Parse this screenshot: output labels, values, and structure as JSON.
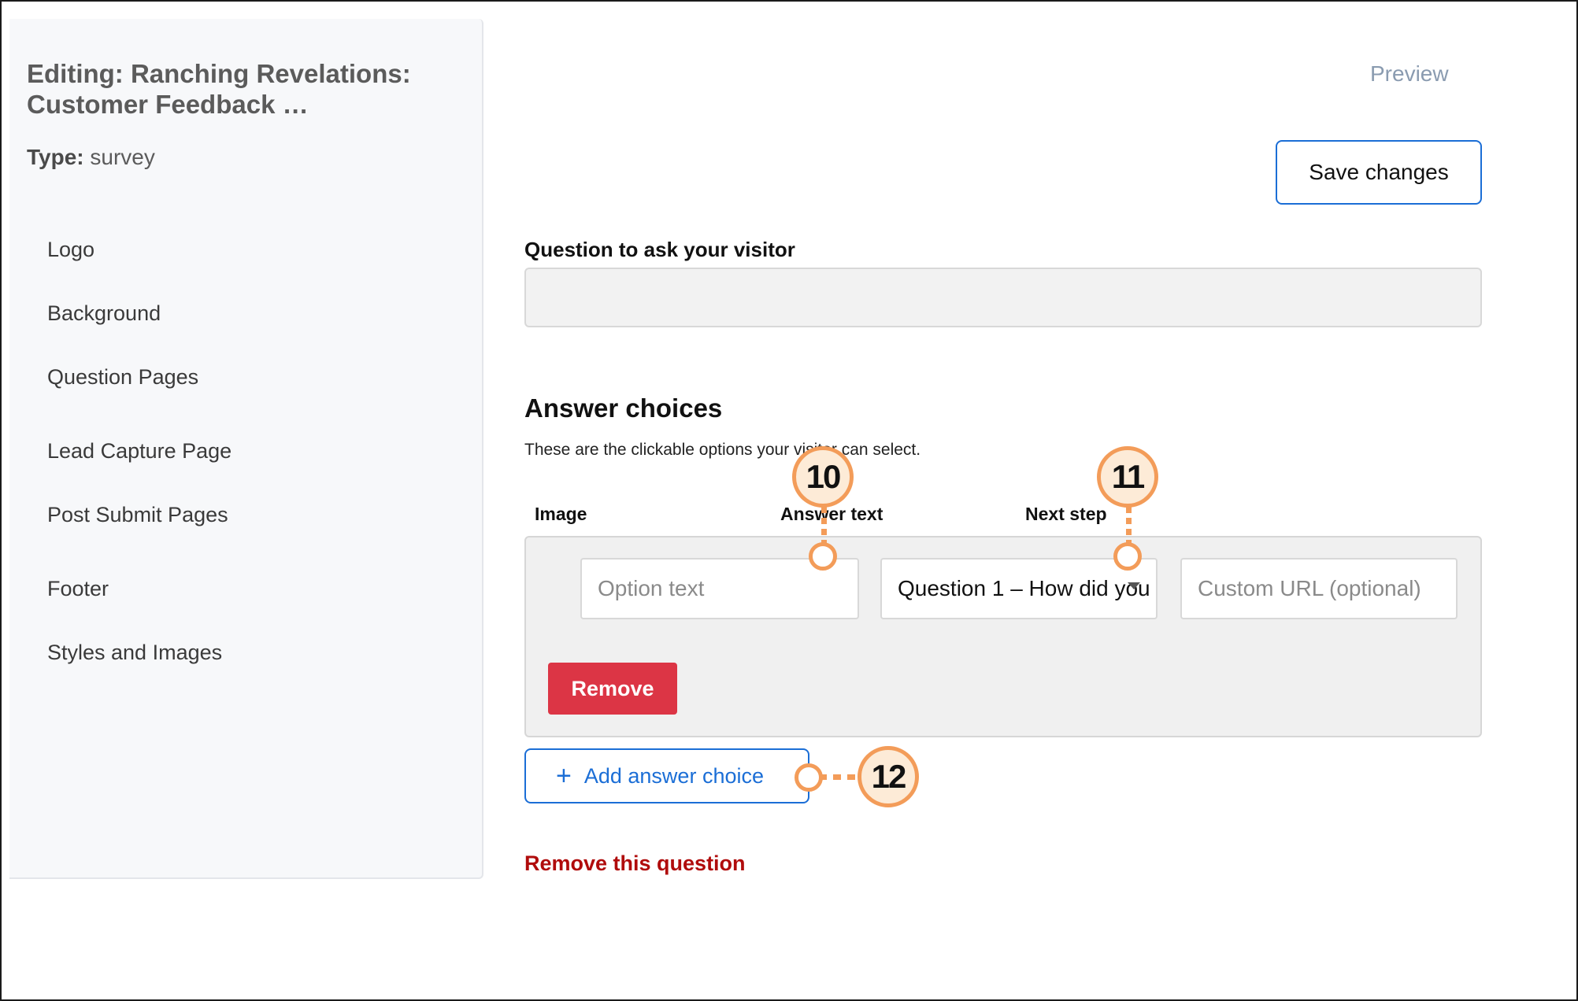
{
  "sidebar": {
    "title": "Editing: Ranching Revelations: Customer Feedback …",
    "type_label": "Type:",
    "type_value": "survey",
    "items": [
      {
        "label": "Logo"
      },
      {
        "label": "Background"
      },
      {
        "label": "Question Pages"
      },
      {
        "label": "Lead Capture Page"
      },
      {
        "label": "Post Submit Pages"
      },
      {
        "label": "Footer"
      },
      {
        "label": "Styles and Images"
      }
    ]
  },
  "header": {
    "preview_label": "Preview",
    "save_label": "Save changes"
  },
  "question": {
    "label": "Question to ask your visitor",
    "value": ""
  },
  "answers": {
    "heading": "Answer choices",
    "description": "These are the clickable options your visitor can select.",
    "columns": {
      "image": "Image",
      "answer_text": "Answer text",
      "next_step": "Next step"
    },
    "choice": {
      "option_placeholder": "Option text",
      "next_step_value": "Question 1 – How did you",
      "url_placeholder": "Custom URL (optional)",
      "remove_label": "Remove"
    },
    "add_label": "Add answer choice",
    "remove_question_label": "Remove this question"
  },
  "callouts": [
    "10",
    "11",
    "12"
  ],
  "colors": {
    "accent_blue": "#1b6ed6",
    "danger_red": "#dc3545",
    "link_red": "#b00c0c",
    "callout_orange": "#f39c59"
  }
}
